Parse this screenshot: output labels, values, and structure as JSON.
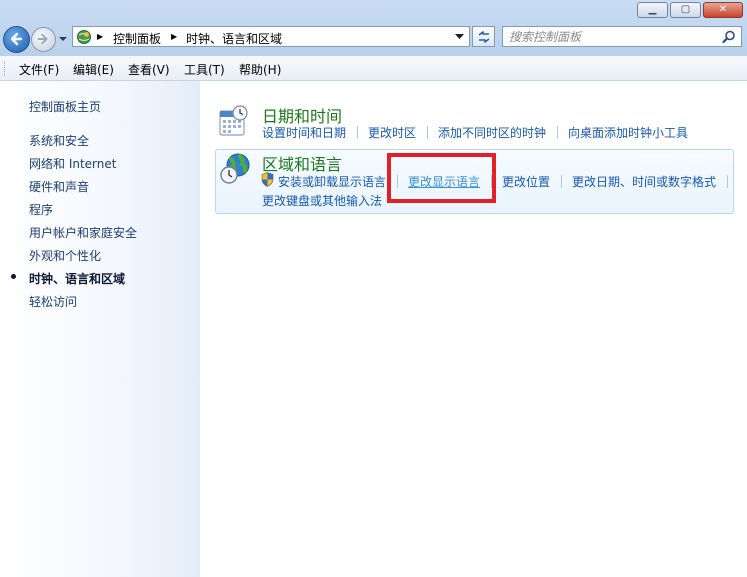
{
  "toolbar": {
    "breadcrumb": [
      "控制面板",
      "时钟、语言和区域"
    ],
    "search_placeholder": "搜索控制面板"
  },
  "menu": [
    "文件(F)",
    "编辑(E)",
    "查看(V)",
    "工具(T)",
    "帮助(H)"
  ],
  "sidebar": {
    "home": "控制面板主页",
    "items": [
      {
        "label": "系统和安全"
      },
      {
        "label": "网络和 Internet"
      },
      {
        "label": "硬件和声音"
      },
      {
        "label": "程序"
      },
      {
        "label": "用户帐户和家庭安全"
      },
      {
        "label": "外观和个性化"
      },
      {
        "label": "时钟、语言和区域",
        "active": true
      },
      {
        "label": "轻松访问"
      }
    ]
  },
  "main": {
    "datetime": {
      "title": "日期和时间",
      "links": [
        "设置时间和日期",
        "更改时区",
        "添加不同时区的时钟",
        "向桌面添加时钟小工具"
      ]
    },
    "region": {
      "title": "区域和语言",
      "links": [
        "安装或卸载显示语言",
        "更改显示语言",
        "更改位置",
        "更改日期、时间或数字格式",
        "更改键盘或其他输入法"
      ]
    }
  },
  "colors": {
    "link": "#1759b5",
    "section_title": "#1a7a1a",
    "highlight": "#e32025"
  },
  "icons": {
    "back": "back-arrow-icon",
    "forward": "forward-arrow-icon",
    "refresh": "refresh-icon",
    "search": "magnifier-icon",
    "datetime": "calendar-clock-icon",
    "region": "globe-clock-icon",
    "shield": "uac-shield-icon"
  }
}
